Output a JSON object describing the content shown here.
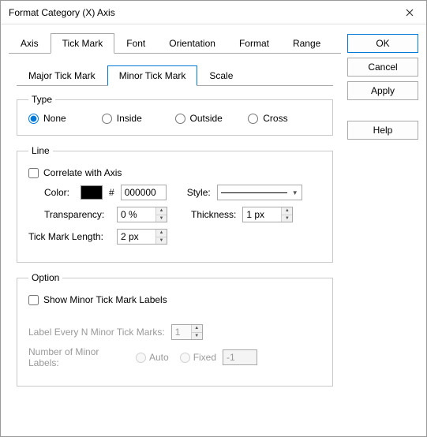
{
  "window": {
    "title": "Format Category (X) Axis"
  },
  "sideButtons": {
    "ok": "OK",
    "cancel": "Cancel",
    "apply": "Apply",
    "help": "Help"
  },
  "outerTabs": {
    "items": [
      "Axis",
      "Tick Mark",
      "Font",
      "Orientation",
      "Format",
      "Range"
    ],
    "selected": "Tick Mark"
  },
  "innerTabs": {
    "items": [
      "Major Tick Mark",
      "Minor Tick Mark",
      "Scale"
    ],
    "selected": "Minor Tick Mark"
  },
  "typeGroup": {
    "legend": "Type",
    "options": {
      "none": "None",
      "inside": "Inside",
      "outside": "Outside",
      "cross": "Cross"
    },
    "selected": "none"
  },
  "lineGroup": {
    "legend": "Line",
    "correlate": {
      "label": "Correlate with Axis",
      "checked": false
    },
    "colorLabel": "Color:",
    "hash": "#",
    "colorValue": "000000",
    "styleLabel": "Style:",
    "transparencyLabel": "Transparency:",
    "transparencyValue": "0 %",
    "thicknessLabel": "Thickness:",
    "thicknessValue": "1 px",
    "tickLengthLabel": "Tick Mark Length:",
    "tickLengthValue": "2 px"
  },
  "optionGroup": {
    "legend": "Option",
    "showLabels": {
      "label": "Show Minor Tick Mark Labels",
      "checked": false
    },
    "labelEveryLabel": "Label Every N Minor Tick Marks:",
    "labelEveryValue": "1",
    "numLabelsLabel": "Number of Minor Labels:",
    "autoLabel": "Auto",
    "fixedLabel": "Fixed",
    "fixedValue": "-1"
  }
}
